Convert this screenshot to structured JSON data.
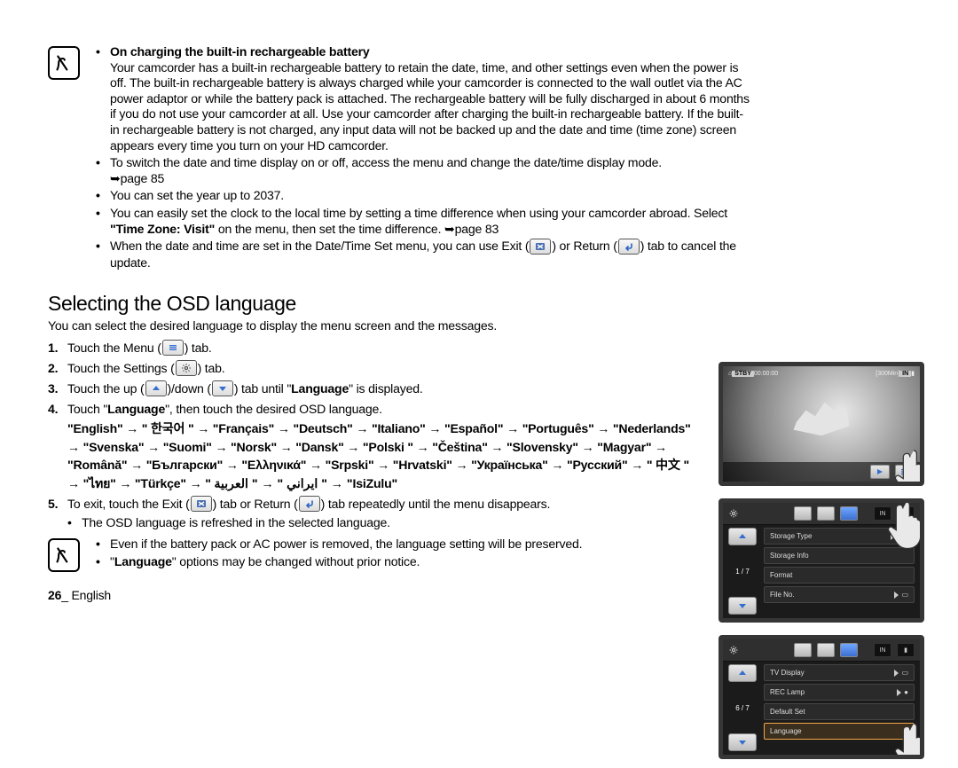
{
  "note1": {
    "heading": "On charging the built-in rechargeable battery",
    "body": "Your camcorder has a built-in rechargeable battery to retain the date, time, and other settings even when the power is off. The built-in rechargeable battery is always charged while your camcorder is connected to the wall outlet via the AC power adaptor or while the battery pack is attached. The rechargeable battery will be fully discharged in about 6 months if you do not use your camcorder at all. Use your camcorder after charging the built-in rechargeable battery. If the built-in rechargeable battery is not charged, any input data will not be backed up and the date and time (time zone) screen appears every time you turn on your HD camcorder.",
    "b2": "To switch the date and time display on or off, access the menu and change the date/time display mode.",
    "b2_ref": "➥page 85",
    "b3": "You can set the year up to 2037.",
    "b4a": "You can easily set the clock to the local time by setting a time difference when using your camcorder abroad. Select ",
    "b4_bold": "\"Time Zone: Visit\"",
    "b4b": " on the menu, then set the time difference. ➥page 83",
    "b5a": "When the date and time are set in the Date/Time Set menu, you can use Exit (",
    "b5b": ") or Return (",
    "b5c": ") tab to cancel the update."
  },
  "osd": {
    "heading": "Selecting the OSD language",
    "intro": "You can select the desired language to display the menu screen and the messages.",
    "s1a": "Touch the Menu (",
    "s1b": ") tab.",
    "s2a": "Touch the Settings (",
    "s2b": ") tab.",
    "s3a": "Touch the up (",
    "s3b": ")/down (",
    "s3c": ") tab until \"",
    "s3_bold": "Language",
    "s3d": "\" is displayed.",
    "s4a": "Touch \"",
    "s4_bold": "Language",
    "s4b": "\", then touch the desired OSD language.",
    "s5a": "To exit, touch the Exit (",
    "s5b": ") tab or Return (",
    "s5c": ") tab repeatedly until the menu disappears.",
    "s5_sub": "The OSD language is refreshed in the selected language.",
    "lang_chain": "\"English\" → \" 한국어 \" → \"Français\" → \"Deutsch\" → \"Italiano\" → \"Español\" → \"Português\" → \"Nederlands\" → \"Svenska\" → \"Suomi\" → \"Norsk\" → \"Dansk\" → \"Polski \" → \"Čeština\" → \"Slovensky\" → \"Magyar\" → \"Română\" → \"Български\" → \"Ελληνικά\" → \"Srpski\" → \"Hrvatski\" → \"Українська\" → \"Русский\" → \" 中文 \" → \"ไทย\" → \"Türkçe\" → \" ايراني \" → \" العربية \" → \"IsiZulu\""
  },
  "note2": {
    "b1": "Even if the battery pack or AC power is removed, the language setting will be preserved.",
    "b2a": "\"",
    "b2_bold": "Language",
    "b2b": "\" options may be changed without prior notice."
  },
  "footer": {
    "page": "26",
    "lang": "English"
  },
  "screen_top": {
    "stby": "STBY",
    "time": "00:00:00",
    "remain": "[300Min]",
    "memory": "IN"
  },
  "screen_settings1": {
    "pagecount": "1 / 7",
    "rows": [
      "Storage Type",
      "Storage Info",
      "Format",
      "File No."
    ],
    "in_tag": "IN"
  },
  "screen_settings2": {
    "pagecount": "6 / 7",
    "rows": [
      "TV Display",
      "REC Lamp",
      "Default Set",
      "Language"
    ]
  }
}
